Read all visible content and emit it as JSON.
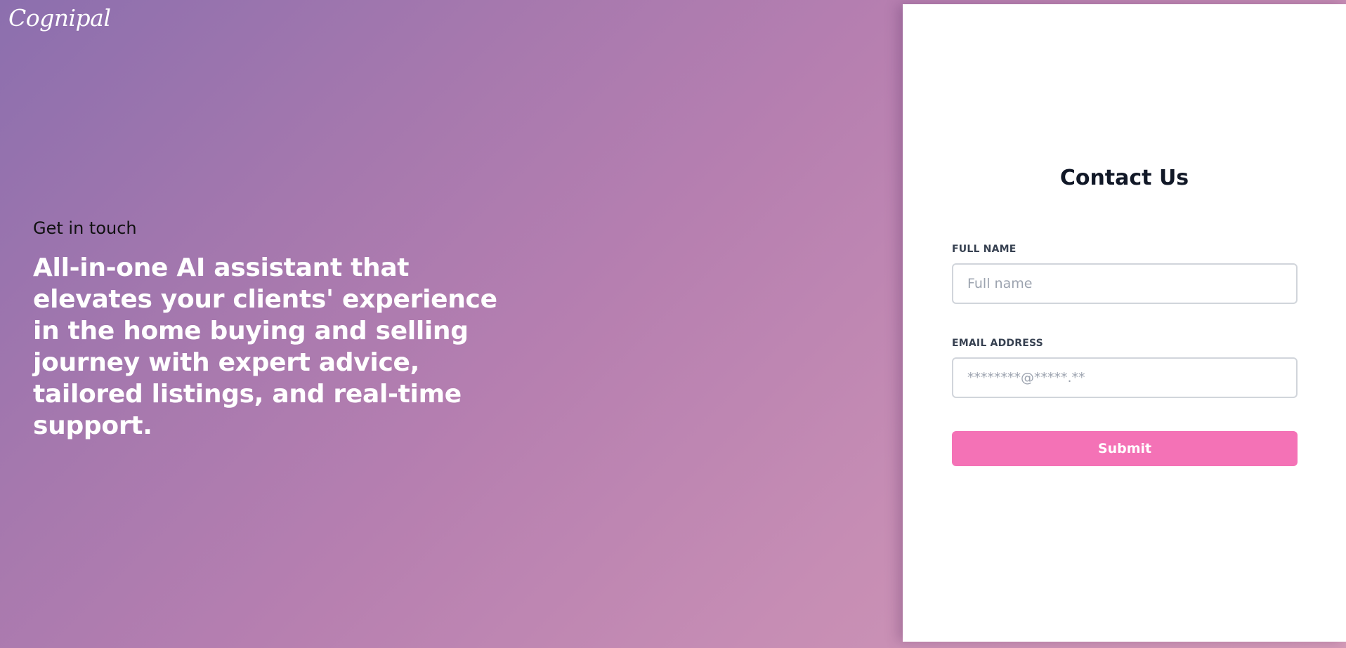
{
  "brand": {
    "logo_text": "Cognipal"
  },
  "hero": {
    "eyebrow": "Get in touch",
    "headline": "All-in-one AI assistant that elevates your clients' experience in the home buying and selling journey with expert advice, tailored listings, and real-time support."
  },
  "contact_form": {
    "title": "Contact Us",
    "full_name": {
      "label": "FULL NAME",
      "placeholder": "Full name",
      "value": ""
    },
    "email": {
      "label": "EMAIL ADDRESS",
      "placeholder": "********@*****.**",
      "value": ""
    },
    "submit_label": "Submit"
  },
  "colors": {
    "gradient_start": "#8c6fae",
    "gradient_end": "#d49bb8",
    "submit_button": "#f472b6",
    "panel_background": "#ffffff",
    "title_text": "#111827"
  }
}
